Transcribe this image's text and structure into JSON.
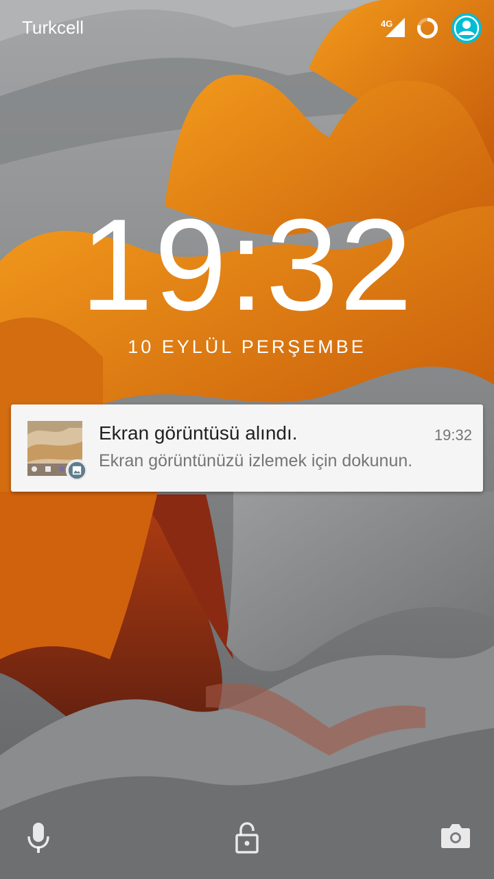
{
  "status_bar": {
    "carrier": "Turkcell",
    "network_type": "4G",
    "signal_icon": "cellular-signal-icon",
    "battery_icon": "battery-ring-icon",
    "user_icon": "user-avatar-icon",
    "accent_color": "#00bcd4"
  },
  "lockscreen": {
    "time": "19:32",
    "date": "10 EYLÜL PERŞEMBE"
  },
  "notification": {
    "title": "Ekran görüntüsü alındı.",
    "text": "Ekran görüntünüzü izlemek için dokunun.",
    "time": "19:32",
    "thumbnail_icon": "screenshot-thumbnail",
    "badge_icon": "image-icon",
    "badge_color": "#607d8b"
  },
  "bottom_actions": {
    "left_icon": "microphone-icon",
    "center_icon": "lock-icon",
    "right_icon": "camera-icon"
  },
  "colors": {
    "wallpaper_orange": "#e07f12",
    "wallpaper_gray": "#8c8e90",
    "wallpaper_red": "#8a2a12"
  }
}
